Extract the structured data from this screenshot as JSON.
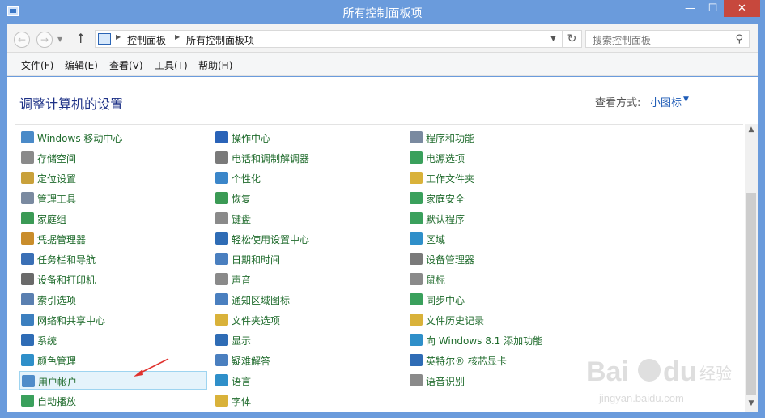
{
  "window": {
    "title": "所有控制面板项",
    "minimize": "—",
    "maximize": "☐",
    "close": "✕"
  },
  "address": {
    "back": "←",
    "forward": "→",
    "up": "↑",
    "crumbs": [
      "控制面板",
      "所有控制面板项"
    ],
    "refresh": "↻",
    "search_placeholder": "搜索控制面板"
  },
  "menu": [
    "文件(F)",
    "编辑(E)",
    "查看(V)",
    "工具(T)",
    "帮助(H)"
  ],
  "page": {
    "heading": "调整计算机的设置",
    "view_by_label": "查看方式:",
    "view_by_value": "小图标"
  },
  "columns": [
    [
      {
        "label": "Windows 移动中心",
        "icon": "mobility-center-icon",
        "color": "#4a8ac8"
      },
      {
        "label": "存储空间",
        "icon": "storage-spaces-icon",
        "color": "#8a8a8a"
      },
      {
        "label": "定位设置",
        "icon": "location-settings-icon",
        "color": "#c9a13b"
      },
      {
        "label": "管理工具",
        "icon": "admin-tools-icon",
        "color": "#7a8aa0"
      },
      {
        "label": "家庭组",
        "icon": "homegroup-icon",
        "color": "#3b9a55"
      },
      {
        "label": "凭据管理器",
        "icon": "credential-manager-icon",
        "color": "#c98d2b"
      },
      {
        "label": "任务栏和导航",
        "icon": "taskbar-icon",
        "color": "#3a6fb5"
      },
      {
        "label": "设备和打印机",
        "icon": "printer-icon",
        "color": "#6a6a6a"
      },
      {
        "label": "索引选项",
        "icon": "indexing-icon",
        "color": "#5a7fb0"
      },
      {
        "label": "网络和共享中心",
        "icon": "network-icon",
        "color": "#3c7fbf"
      },
      {
        "label": "系统",
        "icon": "system-icon",
        "color": "#2f6cb5"
      },
      {
        "label": "颜色管理",
        "icon": "color-management-icon",
        "color": "#2f8fc9"
      },
      {
        "label": "用户帐户",
        "icon": "user-accounts-icon",
        "color": "#4f8cc9"
      },
      {
        "label": "自动播放",
        "icon": "autoplay-icon",
        "color": "#3aa05c"
      }
    ],
    [
      {
        "label": "操作中心",
        "icon": "action-center-icon",
        "color": "#2a63b8"
      },
      {
        "label": "电话和调制解调器",
        "icon": "phone-modem-icon",
        "color": "#7a7a7a"
      },
      {
        "label": "个性化",
        "icon": "personalization-icon",
        "color": "#3b86c9"
      },
      {
        "label": "恢复",
        "icon": "recovery-icon",
        "color": "#3b9a55"
      },
      {
        "label": "键盘",
        "icon": "keyboard-icon",
        "color": "#8a8a8a"
      },
      {
        "label": "轻松使用设置中心",
        "icon": "ease-of-access-icon",
        "color": "#2f6cb5"
      },
      {
        "label": "日期和时间",
        "icon": "date-time-icon",
        "color": "#4a7fbf"
      },
      {
        "label": "声音",
        "icon": "sound-icon",
        "color": "#8a8a8a"
      },
      {
        "label": "通知区域图标",
        "icon": "notification-area-icon",
        "color": "#4a7fbf"
      },
      {
        "label": "文件夹选项",
        "icon": "folder-options-icon",
        "color": "#d9b23a"
      },
      {
        "label": "显示",
        "icon": "display-icon",
        "color": "#2f6cb5"
      },
      {
        "label": "疑难解答",
        "icon": "troubleshooting-icon",
        "color": "#4a7fbf"
      },
      {
        "label": "语言",
        "icon": "language-icon",
        "color": "#2f8fc9"
      },
      {
        "label": "字体",
        "icon": "fonts-icon",
        "color": "#d9b23a"
      }
    ],
    [
      {
        "label": "程序和功能",
        "icon": "programs-features-icon",
        "color": "#7a8aa0"
      },
      {
        "label": "电源选项",
        "icon": "power-options-icon",
        "color": "#3aa05c"
      },
      {
        "label": "工作文件夹",
        "icon": "work-folders-icon",
        "color": "#d9b23a"
      },
      {
        "label": "家庭安全",
        "icon": "family-safety-icon",
        "color": "#3aa05c"
      },
      {
        "label": "默认程序",
        "icon": "default-programs-icon",
        "color": "#3aa05c"
      },
      {
        "label": "区域",
        "icon": "region-icon",
        "color": "#2f8fc9"
      },
      {
        "label": "设备管理器",
        "icon": "device-manager-icon",
        "color": "#7a7a7a"
      },
      {
        "label": "鼠标",
        "icon": "mouse-icon",
        "color": "#8a8a8a"
      },
      {
        "label": "同步中心",
        "icon": "sync-center-icon",
        "color": "#3aa05c"
      },
      {
        "label": "文件历史记录",
        "icon": "file-history-icon",
        "color": "#d9b23a"
      },
      {
        "label": "向 Windows 8.1 添加功能",
        "icon": "add-features-icon",
        "color": "#2f8fc9"
      },
      {
        "label": "英特尔® 核芯显卡",
        "icon": "intel-graphics-icon",
        "color": "#2f6cb5"
      },
      {
        "label": "语音识别",
        "icon": "speech-recognition-icon",
        "color": "#8a8a8a"
      }
    ]
  ],
  "selected_item": "用户帐户",
  "watermark": "Bai du 经验",
  "watermark_url": "jingyan.baidu.com"
}
